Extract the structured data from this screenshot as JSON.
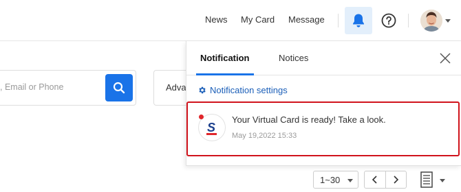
{
  "header": {
    "nav": {
      "news": "News",
      "my_card": "My Card",
      "message": "Message"
    }
  },
  "search": {
    "placeholder_visible": ", Email or Phone"
  },
  "advanced": {
    "label": "Adva"
  },
  "notification_panel": {
    "tabs": [
      {
        "label": "Notification",
        "active": true
      },
      {
        "label": "Notices",
        "active": false
      }
    ],
    "settings_label": "Notification settings",
    "items": [
      {
        "message": "Your Virtual Card is ready! Take a look.",
        "timestamp": "May 19,2022 15:33",
        "unread": true
      }
    ]
  },
  "pagination": {
    "range": "1~30"
  },
  "colors": {
    "accent": "#1a73e8",
    "highlight_border": "#d0121b",
    "unread_dot": "#e0262b",
    "bell_bg": "#e3effb"
  }
}
